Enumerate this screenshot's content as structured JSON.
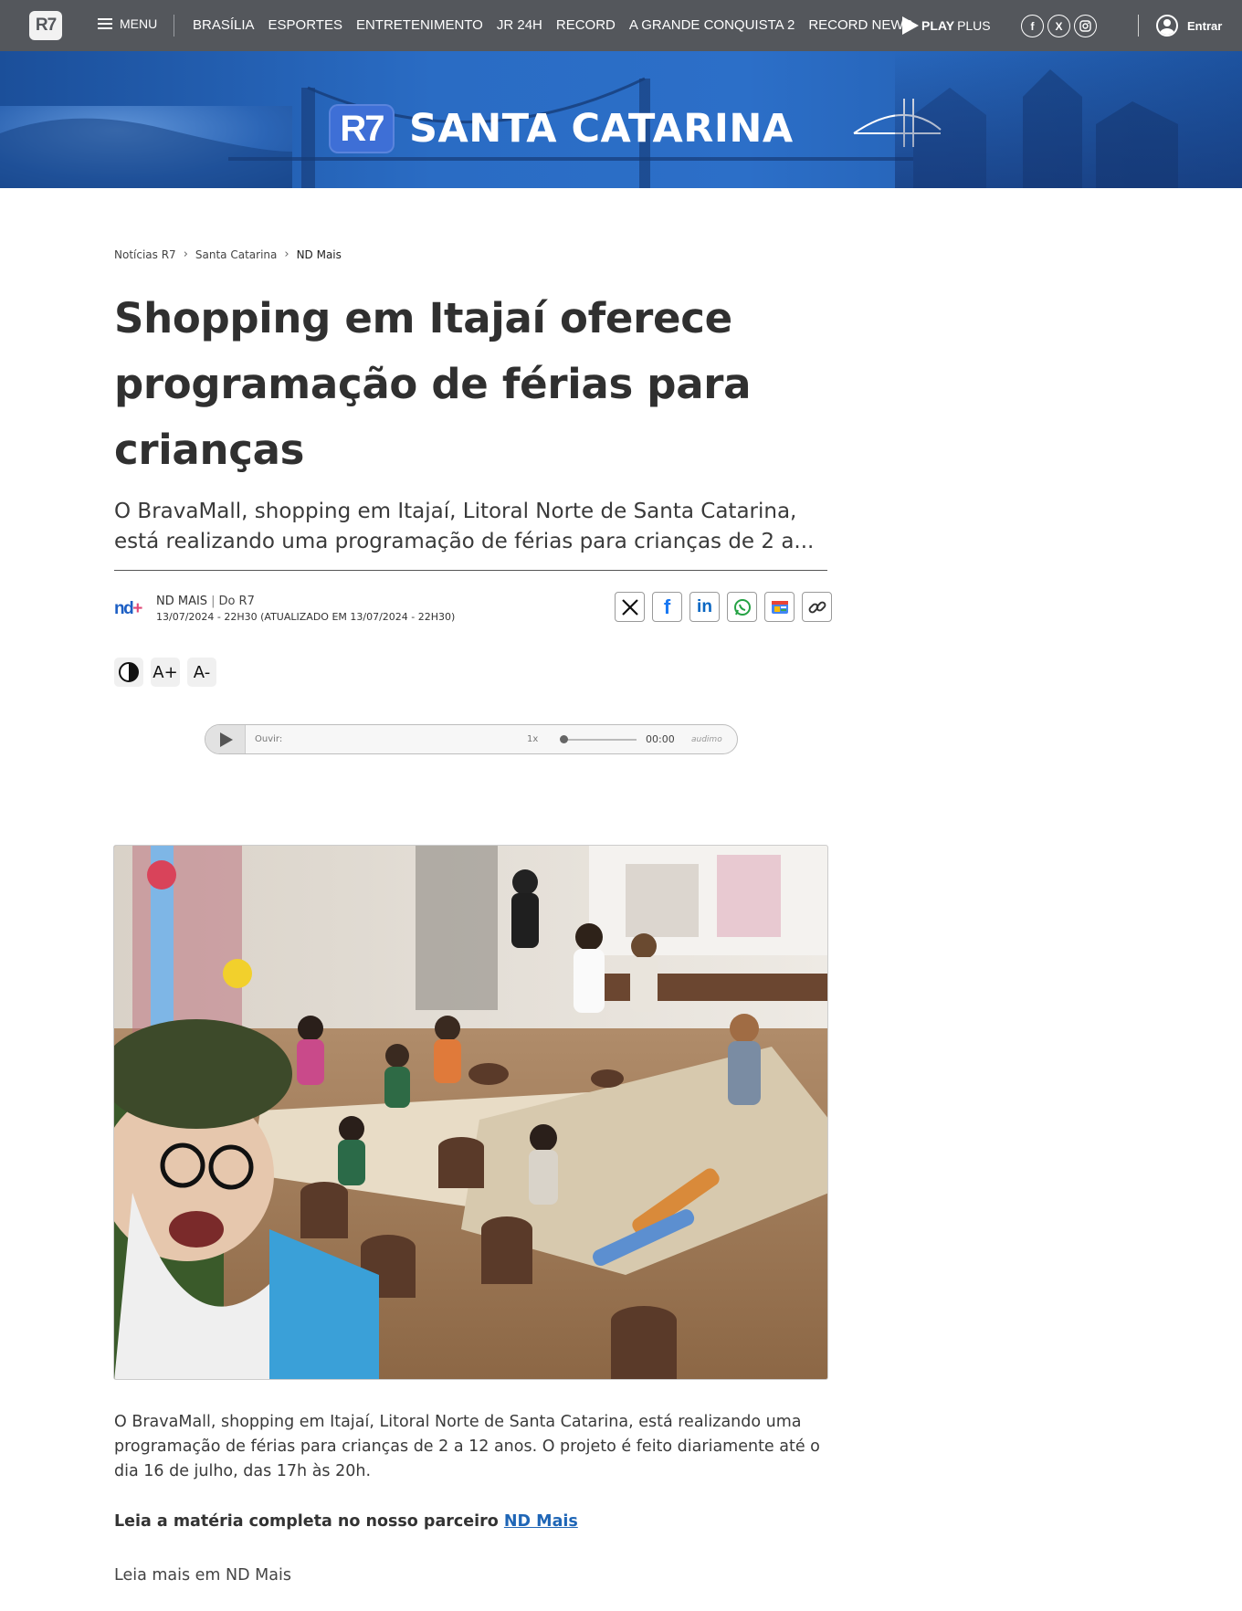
{
  "nav": {
    "logo": "R7",
    "menu_label": "MENU",
    "links": [
      "BRASÍLIA",
      "ESPORTES",
      "ENTRETENIMENTO",
      "JR 24H",
      "RECORD",
      "A GRANDE CONQUISTA 2",
      "RECORD NEWS"
    ],
    "playplus_bold": "PLAY",
    "playplus_rest": "PLUS",
    "socials": [
      "facebook-icon",
      "x-icon",
      "instagram-icon"
    ],
    "login_label": "Entrar"
  },
  "banner": {
    "logo": "R7",
    "title": "SANTA CATARINA"
  },
  "breadcrumb": [
    "Notícias R7",
    "Santa Catarina",
    "ND Mais"
  ],
  "article": {
    "headline": "Shopping em Itajaí oferece programação de férias para crianças",
    "subtitle": "O BravaMall, shopping em Itajaí, Litoral Norte de Santa Catarina, está realizando uma programação de férias para crianças de 2 a...",
    "source": "ND MAIS",
    "origin": "Do R7",
    "date": "13/07/2024 - 22H30 (ATUALIZADO EM 13/07/2024 - 22H30)",
    "body": "O BravaMall, shopping em Itajaí, Litoral Norte de Santa Catarina, está realizando uma programação de férias para crianças de 2 a 12 anos. O projeto é feito diariamente até o dia 16 de julho, das 17h às 20h.",
    "partner_prefix": "Leia a matéria completa no nosso parceiro",
    "partner_link": "ND Mais",
    "read_more": "Leia mais em ND Mais"
  },
  "share": [
    "x-icon",
    "facebook-icon",
    "linkedin-icon",
    "whatsapp-icon",
    "google-news-icon",
    "link-icon"
  ],
  "accessibility": {
    "increase": "A+",
    "decrease": "A-"
  },
  "player": {
    "label": "Ouvir:",
    "speed": "1x",
    "time": "00:00",
    "brand": "audimo"
  },
  "colors": {
    "nav_bg": "#54575c",
    "banner_blue": "#2a6cc4",
    "link": "#1f66b6"
  }
}
